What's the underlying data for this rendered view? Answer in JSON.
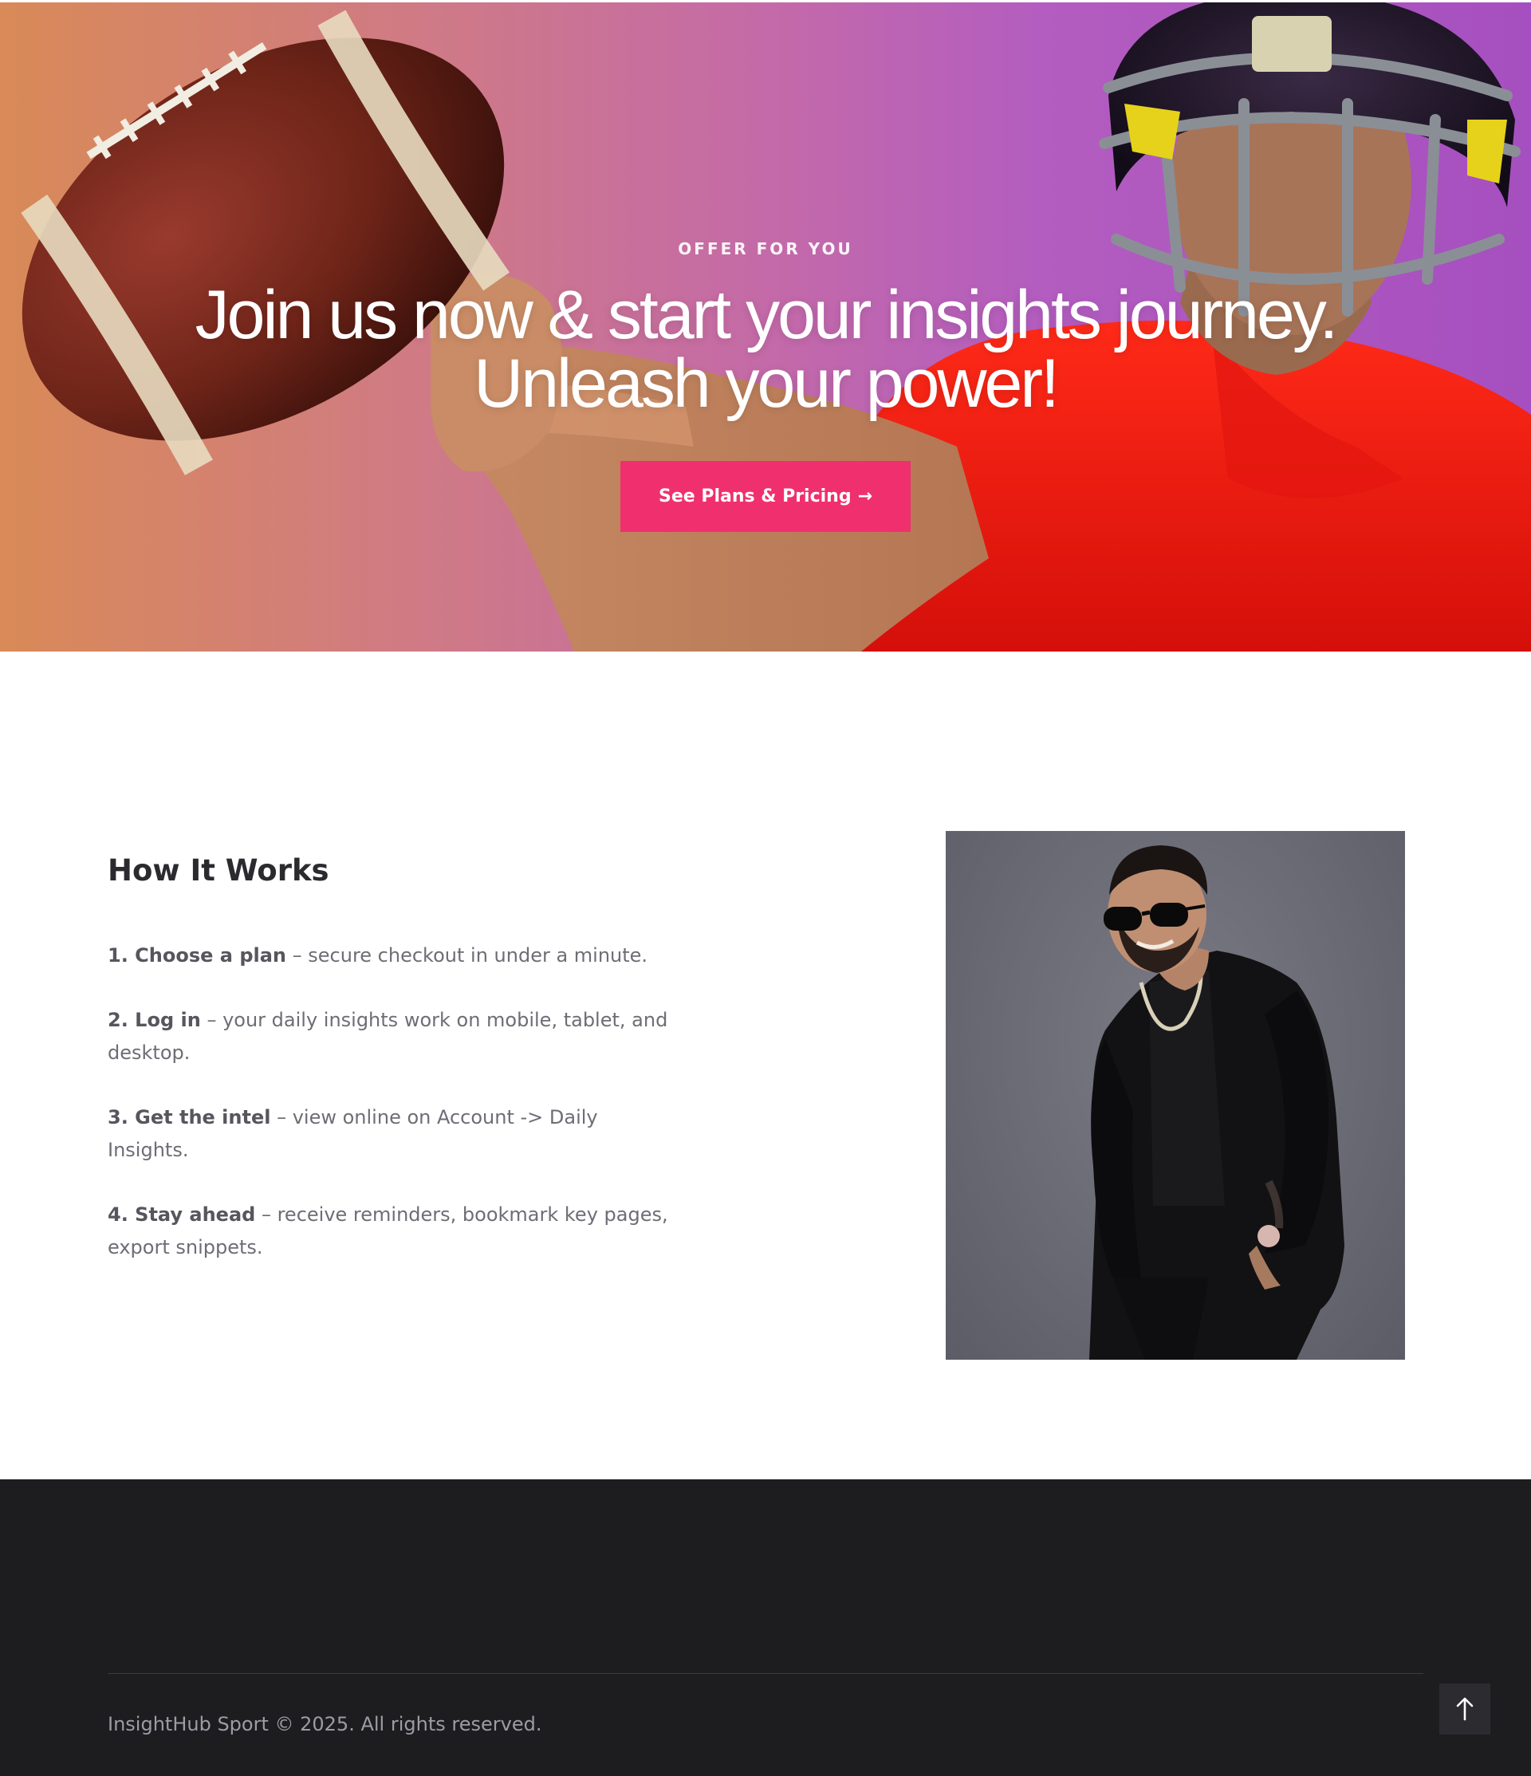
{
  "hero": {
    "eyebrow": "OFFER FOR YOU",
    "title_line1": "Join us now & start your insights journey.",
    "title_line2": "Unleash your power!",
    "cta_label": "See Plans & Pricing",
    "cta_arrow": "→",
    "image": "football-player-throwing-ball"
  },
  "how_it_works": {
    "title": "How It Works",
    "steps": [
      {
        "label": "1. Choose a plan",
        "text": " – secure checkout in under a minute."
      },
      {
        "label": "2. Log in",
        "text": " – your daily insights work on mobile, tablet, and desktop."
      },
      {
        "label": "3. Get the intel",
        "text": " – view online on Account -> Daily Insights."
      },
      {
        "label": "4. Stay ahead",
        "text": " – receive reminders, bookmark key pages, export snippets."
      }
    ],
    "image": "man-in-black-suit-sunglasses-portrait"
  },
  "footer": {
    "copyright": "InsightHub Sport © 2025. All rights reserved.",
    "to_top_icon": "arrow-up-icon"
  },
  "colors": {
    "accent": "#f0306e",
    "footer_bg": "#1d1d20",
    "heading": "#2b2b2f",
    "body_text": "#6d6d75"
  }
}
